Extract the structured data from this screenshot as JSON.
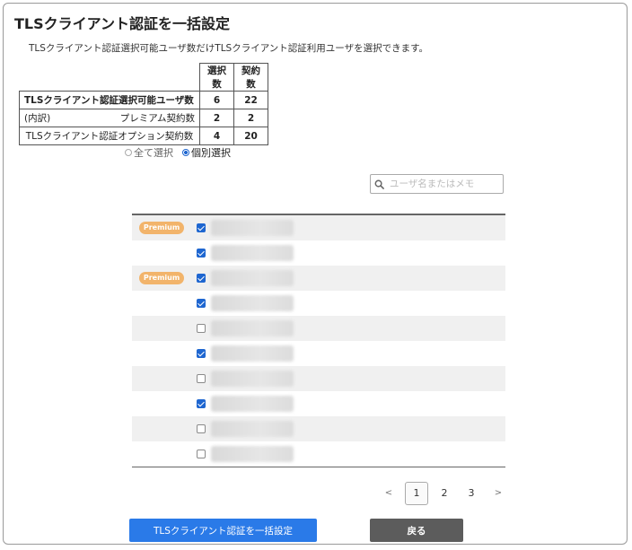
{
  "title": "TLSクライアント認証を一括設定",
  "description": "TLSクライアント認証選択可能ユーザ数だけTLSクライアント認証利用ユーザを選択できます。",
  "summary_table": {
    "headers": [
      "選択数",
      "契約数"
    ],
    "rows": [
      {
        "label": "TLSクライアント認証選択可能ユーザ数",
        "selected": "6",
        "contracted": "22"
      },
      {
        "label_prefix": "(内訳)",
        "label": "プレミアム契約数",
        "selected": "2",
        "contracted": "2"
      },
      {
        "label": "TLSクライアント認証オプション契約数",
        "selected": "4",
        "contracted": "20"
      }
    ]
  },
  "selection_mode": {
    "options": [
      "全て選択",
      "個別選択"
    ],
    "selected": "個別選択"
  },
  "search": {
    "placeholder": "ユーザ名またはメモ",
    "value": ""
  },
  "users": [
    {
      "premium": true,
      "checked": true
    },
    {
      "premium": false,
      "checked": true
    },
    {
      "premium": true,
      "checked": true
    },
    {
      "premium": false,
      "checked": true
    },
    {
      "premium": false,
      "checked": false
    },
    {
      "premium": false,
      "checked": true
    },
    {
      "premium": false,
      "checked": false
    },
    {
      "premium": false,
      "checked": true
    },
    {
      "premium": false,
      "checked": false
    },
    {
      "premium": false,
      "checked": false
    }
  ],
  "badge_label": "Premium",
  "pagination": {
    "prev": "<",
    "pages": [
      "1",
      "2",
      "3"
    ],
    "current": "1",
    "next": ">"
  },
  "buttons": {
    "apply": "TLSクライアント認証を一括設定",
    "back": "戻る"
  },
  "colors": {
    "primary": "#2a7ae8",
    "back": "#5c5c5c",
    "premium_badge": "#f2b46b",
    "checkbox": "#1e66d0"
  }
}
